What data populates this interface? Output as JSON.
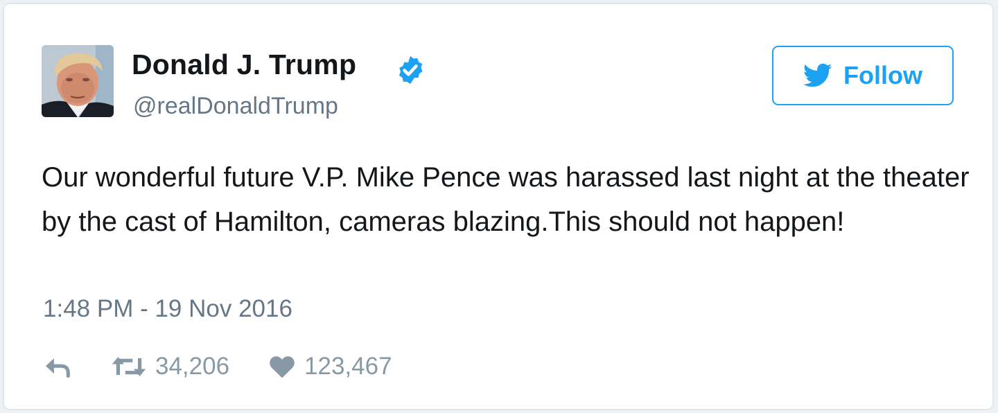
{
  "user": {
    "name": "Donald J. Trump",
    "handle": "@realDonaldTrump",
    "verified": true,
    "avatar_icon": "profile-photo"
  },
  "follow_button": {
    "label": "Follow",
    "icon": "twitter-bird-icon"
  },
  "tweet": {
    "text": "Our wonderful future V.P. Mike Pence was harassed last night at the theater by the cast of Hamilton, cameras blazing.This should not happen!",
    "timestamp": "1:48 PM - 19 Nov 2016"
  },
  "actions": {
    "reply": {
      "icon": "reply-icon"
    },
    "retweet": {
      "icon": "retweet-icon",
      "count": "34,206"
    },
    "like": {
      "icon": "heart-icon",
      "count": "123,467"
    }
  },
  "colors": {
    "brand_blue": "#1da1f2",
    "verified_blue": "#1da1f2",
    "text_primary": "#14171a",
    "text_secondary": "#657786",
    "action_gray": "#8899a6",
    "card_border": "#e1e8ed"
  }
}
